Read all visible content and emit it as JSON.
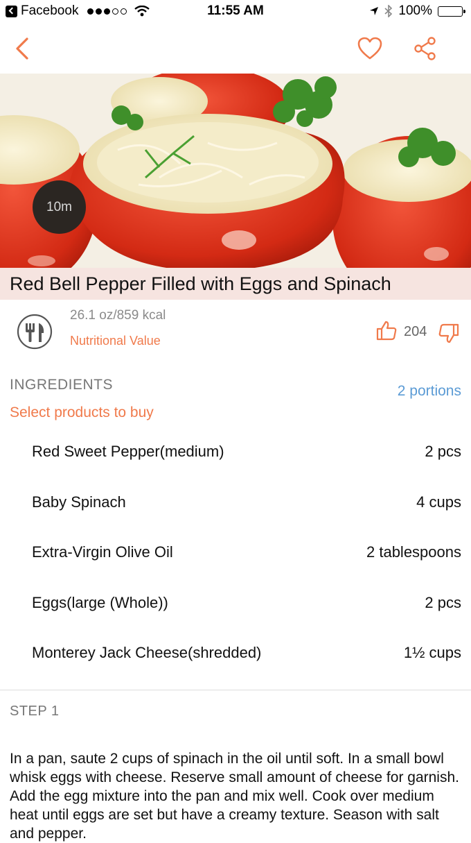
{
  "status_bar": {
    "app_back": "Facebook",
    "time": "11:55 AM",
    "battery": "100%"
  },
  "nav": {
    "back_icon": "chevron-left-icon",
    "favorite_icon": "heart-icon",
    "share_icon": "share-icon",
    "accent_color": "#f07a4b"
  },
  "recipe": {
    "cook_time": "10m",
    "title": "Red Bell Pepper Filled with Eggs and Spinach",
    "nutrition_amount": "26.1 oz/859 kcal",
    "nutrition_link": "Nutritional Value",
    "likes": "204"
  },
  "ingredients": {
    "heading": "INGREDIENTS",
    "portions": "2 portions",
    "select_products": "Select products to buy",
    "items": [
      {
        "name": "Red Sweet Pepper(medium)",
        "qty": "2 pcs"
      },
      {
        "name": "Baby Spinach",
        "qty": "4 cups"
      },
      {
        "name": "Extra-Virgin Olive Oil",
        "qty": "2 tablespoons"
      },
      {
        "name": "Eggs(large (Whole))",
        "qty": "2 pcs"
      },
      {
        "name": "Monterey Jack Cheese(shredded)",
        "qty": "1½ cups"
      }
    ]
  },
  "steps": [
    {
      "label": "STEP 1",
      "text": "In a pan, saute 2 cups of spinach in the oil until soft. In a small bowl whisk eggs with cheese. Reserve small amount of cheese for garnish. Add the egg mixture into the pan and mix well. Cook over medium heat until eggs are set but have a creamy texture. Season with salt and pepper."
    }
  ]
}
